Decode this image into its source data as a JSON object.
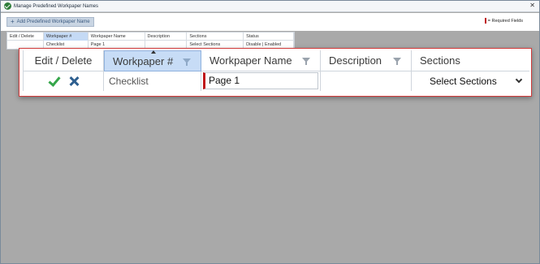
{
  "window": {
    "title": "Manage Predefined Workpaper Names",
    "close_glyph": "✕"
  },
  "toolbar": {
    "add_label": "Add Predefined Workpaper Name",
    "add_icon": "plus-icon",
    "required_label": "= Required Fields"
  },
  "background_grid": {
    "headers": [
      "Edit / Delete",
      "Workpaper #",
      "Workpaper Name",
      "Description",
      "Sections",
      "Status"
    ],
    "row": [
      "",
      "Checklist",
      "Page 1",
      "",
      "Select Sections",
      "Disable | Enabled"
    ]
  },
  "grid": {
    "headers": {
      "edit_delete": "Edit / Delete",
      "workpaper_num": "Workpaper #",
      "workpaper_name": "Workpaper Name",
      "description": "Description",
      "sections": "Sections"
    },
    "row": {
      "workpaper_num": "Checklist",
      "workpaper_name": "Page 1",
      "description": "",
      "sections": "Select Sections"
    }
  },
  "colors": {
    "required": "#c0161a",
    "selected_header": "#c7dcf6",
    "check": "#35a64a",
    "cancel": "#2e5f8f",
    "overlay": "#a9a9a9"
  }
}
